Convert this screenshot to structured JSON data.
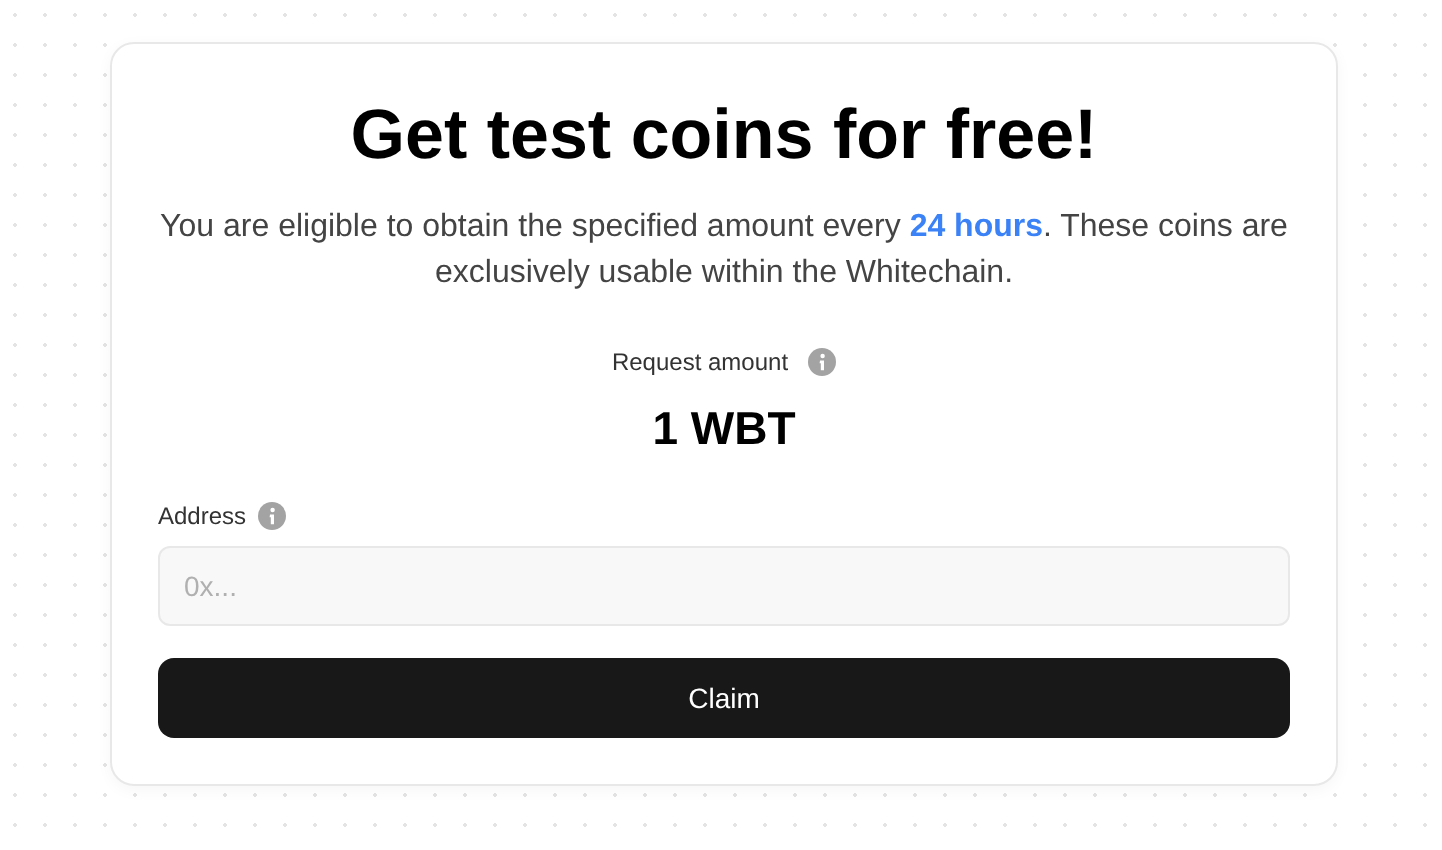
{
  "title": "Get test coins for free!",
  "description": "You are eligible to obtain the specified amount every **24 hours**. These coins are exclusively usable within the Whitechain.",
  "request_amount": {
    "label": "Request amount",
    "value": "1 WBT"
  },
  "address": {
    "label": "Address",
    "placeholder": "0x..."
  },
  "button": "Claim"
}
